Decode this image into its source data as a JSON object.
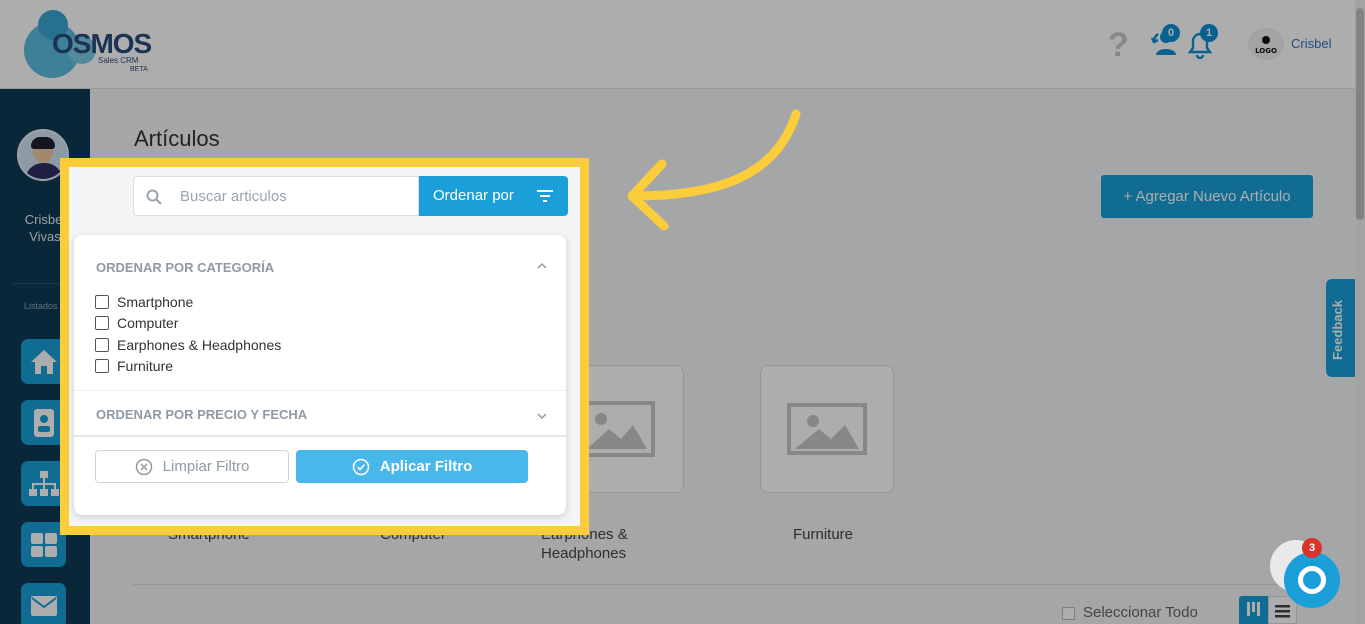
{
  "header": {
    "logo": {
      "brand": "OSMOS",
      "subtitle": "Sales CRM",
      "tag": "BETA"
    },
    "help_icon": "?",
    "user_notifications_badge": "0",
    "bell_badge": "1",
    "company_logo_text": "LOGO",
    "user_name": "Crisbel"
  },
  "sidebar": {
    "user_name_line1": "Crisbel",
    "user_name_line2": "Vivas",
    "section_label": "Listados",
    "items": [
      {
        "icon": "home-icon"
      },
      {
        "icon": "contact-card-icon"
      },
      {
        "icon": "org-chart-icon"
      },
      {
        "icon": "grid-icon"
      },
      {
        "icon": "mail-icon"
      }
    ]
  },
  "main": {
    "title": "Artículos",
    "search_placeholder": "Buscar articulos",
    "order_button": "Ordenar por",
    "add_button": "+ Agregar Nuevo Artículo",
    "categories": [
      {
        "label": "Smartphone"
      },
      {
        "label": "Computer"
      },
      {
        "label": "Earphones &",
        "label2": "Headphones"
      },
      {
        "label": "Furniture"
      }
    ],
    "select_all": "Seleccionar Todo"
  },
  "dropdown": {
    "section1_title": "ORDENAR POR CATEGORÍA",
    "options": [
      "Smartphone",
      "Computer",
      "Earphones & Headphones",
      "Furniture"
    ],
    "section2_title": "ORDENAR POR PRECIO Y FECHA",
    "clear_button": "Limpiar Filtro",
    "apply_button": "Aplicar Filtro"
  },
  "feedback": "Feedback",
  "chat_badge": "3",
  "colors": {
    "accent": "#1a9fd9",
    "highlight": "#fbcd3a",
    "sidebar": "#0d3a55"
  }
}
